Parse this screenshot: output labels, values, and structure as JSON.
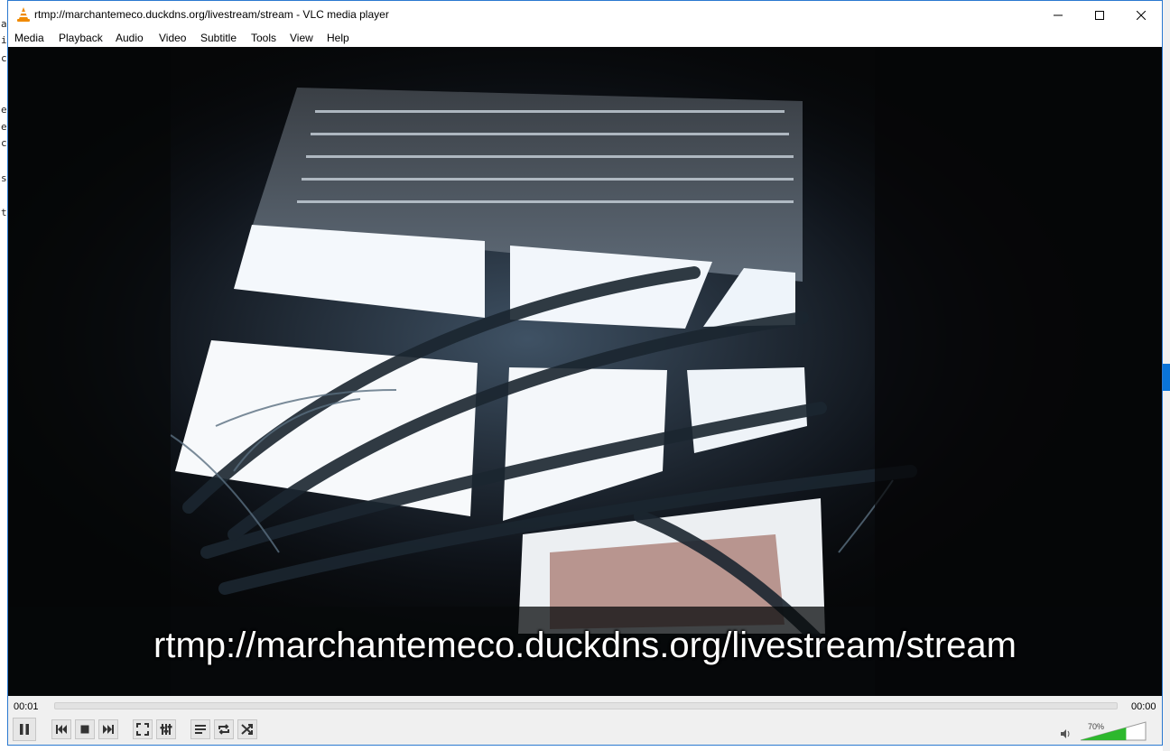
{
  "background": {
    "left_fragments": [
      "a",
      "i",
      "c",
      "e",
      "e",
      "c",
      "s",
      "t"
    ]
  },
  "window": {
    "title": "rtmp://marchantemeco.duckdns.org/livestream/stream - VLC media player",
    "app_icon": "vlc-cone-icon"
  },
  "menu": {
    "items": [
      "Media",
      "Playback",
      "Audio",
      "Video",
      "Subtitle",
      "Tools",
      "View",
      "Help"
    ]
  },
  "video": {
    "overlay_text": "rtmp://marchantemeco.duckdns.org/livestream/stream"
  },
  "controls": {
    "elapsed": "00:01",
    "remaining": "00:00",
    "seek_progress": 0,
    "volume_label": "70%",
    "volume_level": 0.7,
    "buttons": [
      "pause-icon",
      "previous-icon",
      "stop-icon",
      "next-icon",
      "fullscreen-icon",
      "extended-settings-icon",
      "playlist-icon",
      "loop-icon",
      "shuffle-icon"
    ]
  },
  "colors": {
    "accent": "#2b79d0",
    "volume_fill": "#2db82d"
  }
}
